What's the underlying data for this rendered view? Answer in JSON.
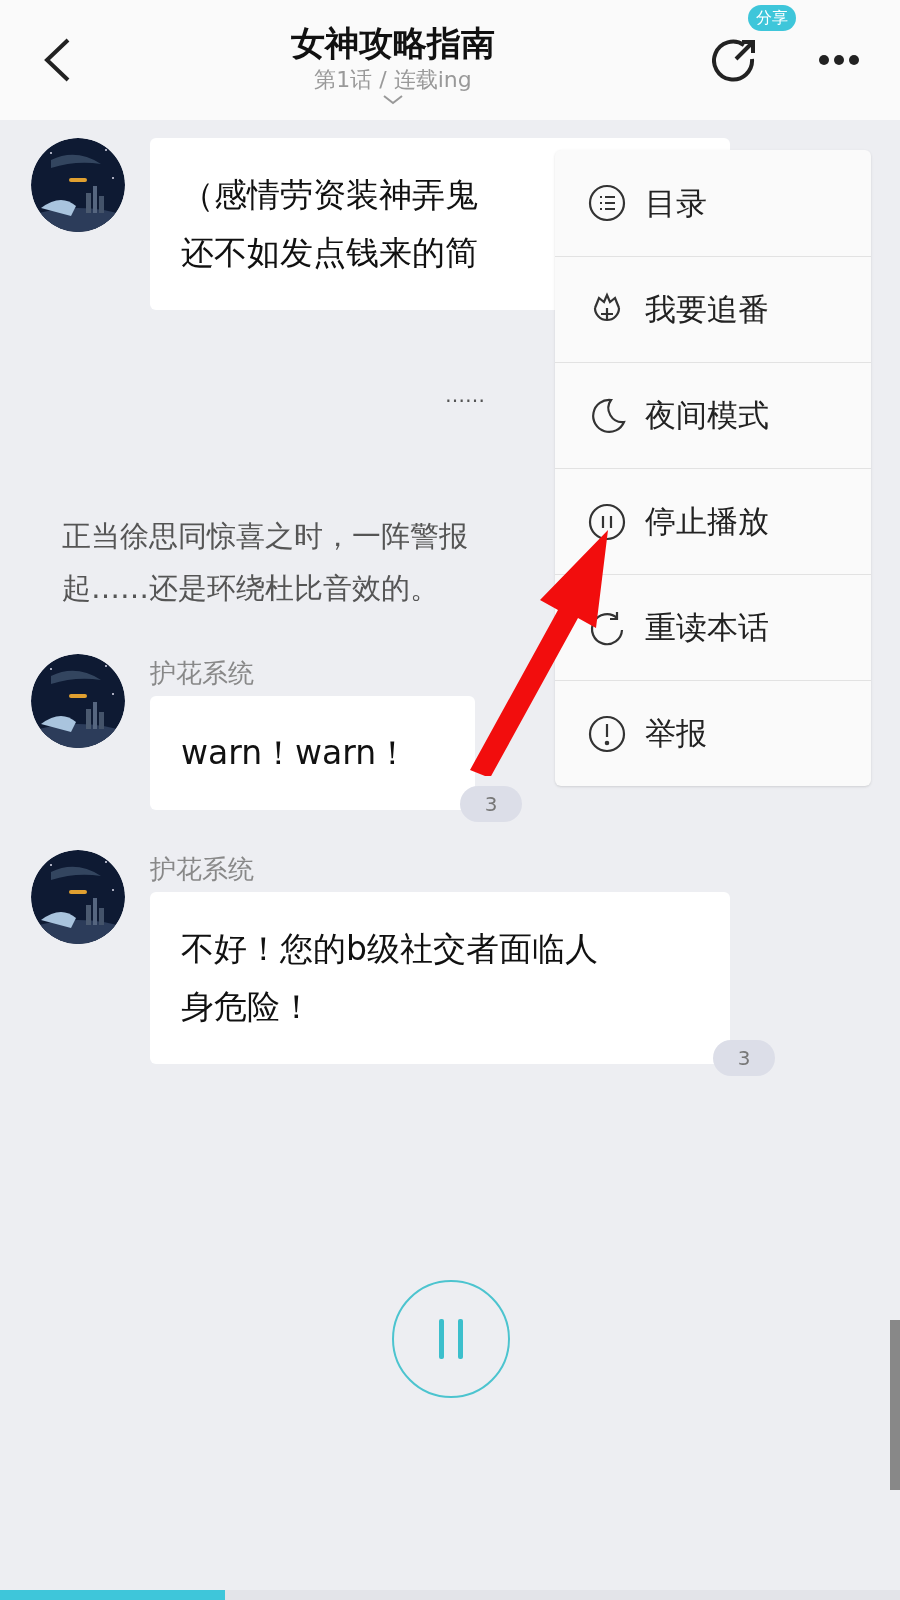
{
  "header": {
    "title": "女神攻略指南",
    "subtitle": "第1话 / 连载ing",
    "share_badge": "分享"
  },
  "messages": [
    {
      "kind": "bubble",
      "lines": [
        "（感情劳资装神弄鬼",
        "还不如发点钱来的简"
      ]
    },
    {
      "kind": "ellipsis",
      "lines": [
        "……"
      ]
    },
    {
      "kind": "narration",
      "lines": [
        "正当徐思同惊喜之时，一阵警报",
        "起……还是环绕杜比音效的。"
      ]
    },
    {
      "kind": "bubble",
      "sender": "护花系统",
      "lines": [
        "warn！warn！"
      ],
      "count": "3"
    },
    {
      "kind": "bubble",
      "sender": "护花系统",
      "lines": [
        "不好！您的b级社交者面临人",
        "身危险！"
      ],
      "count": "3"
    }
  ],
  "menu": [
    {
      "kind": "list",
      "label": "目录"
    },
    {
      "kind": "follow",
      "label": "我要追番"
    },
    {
      "kind": "moon",
      "label": "夜间模式"
    },
    {
      "kind": "pause",
      "label": "停止播放"
    },
    {
      "kind": "reload",
      "label": "重读本话"
    },
    {
      "kind": "alert",
      "label": "举报"
    }
  ],
  "progress": {
    "level": 0.25
  }
}
